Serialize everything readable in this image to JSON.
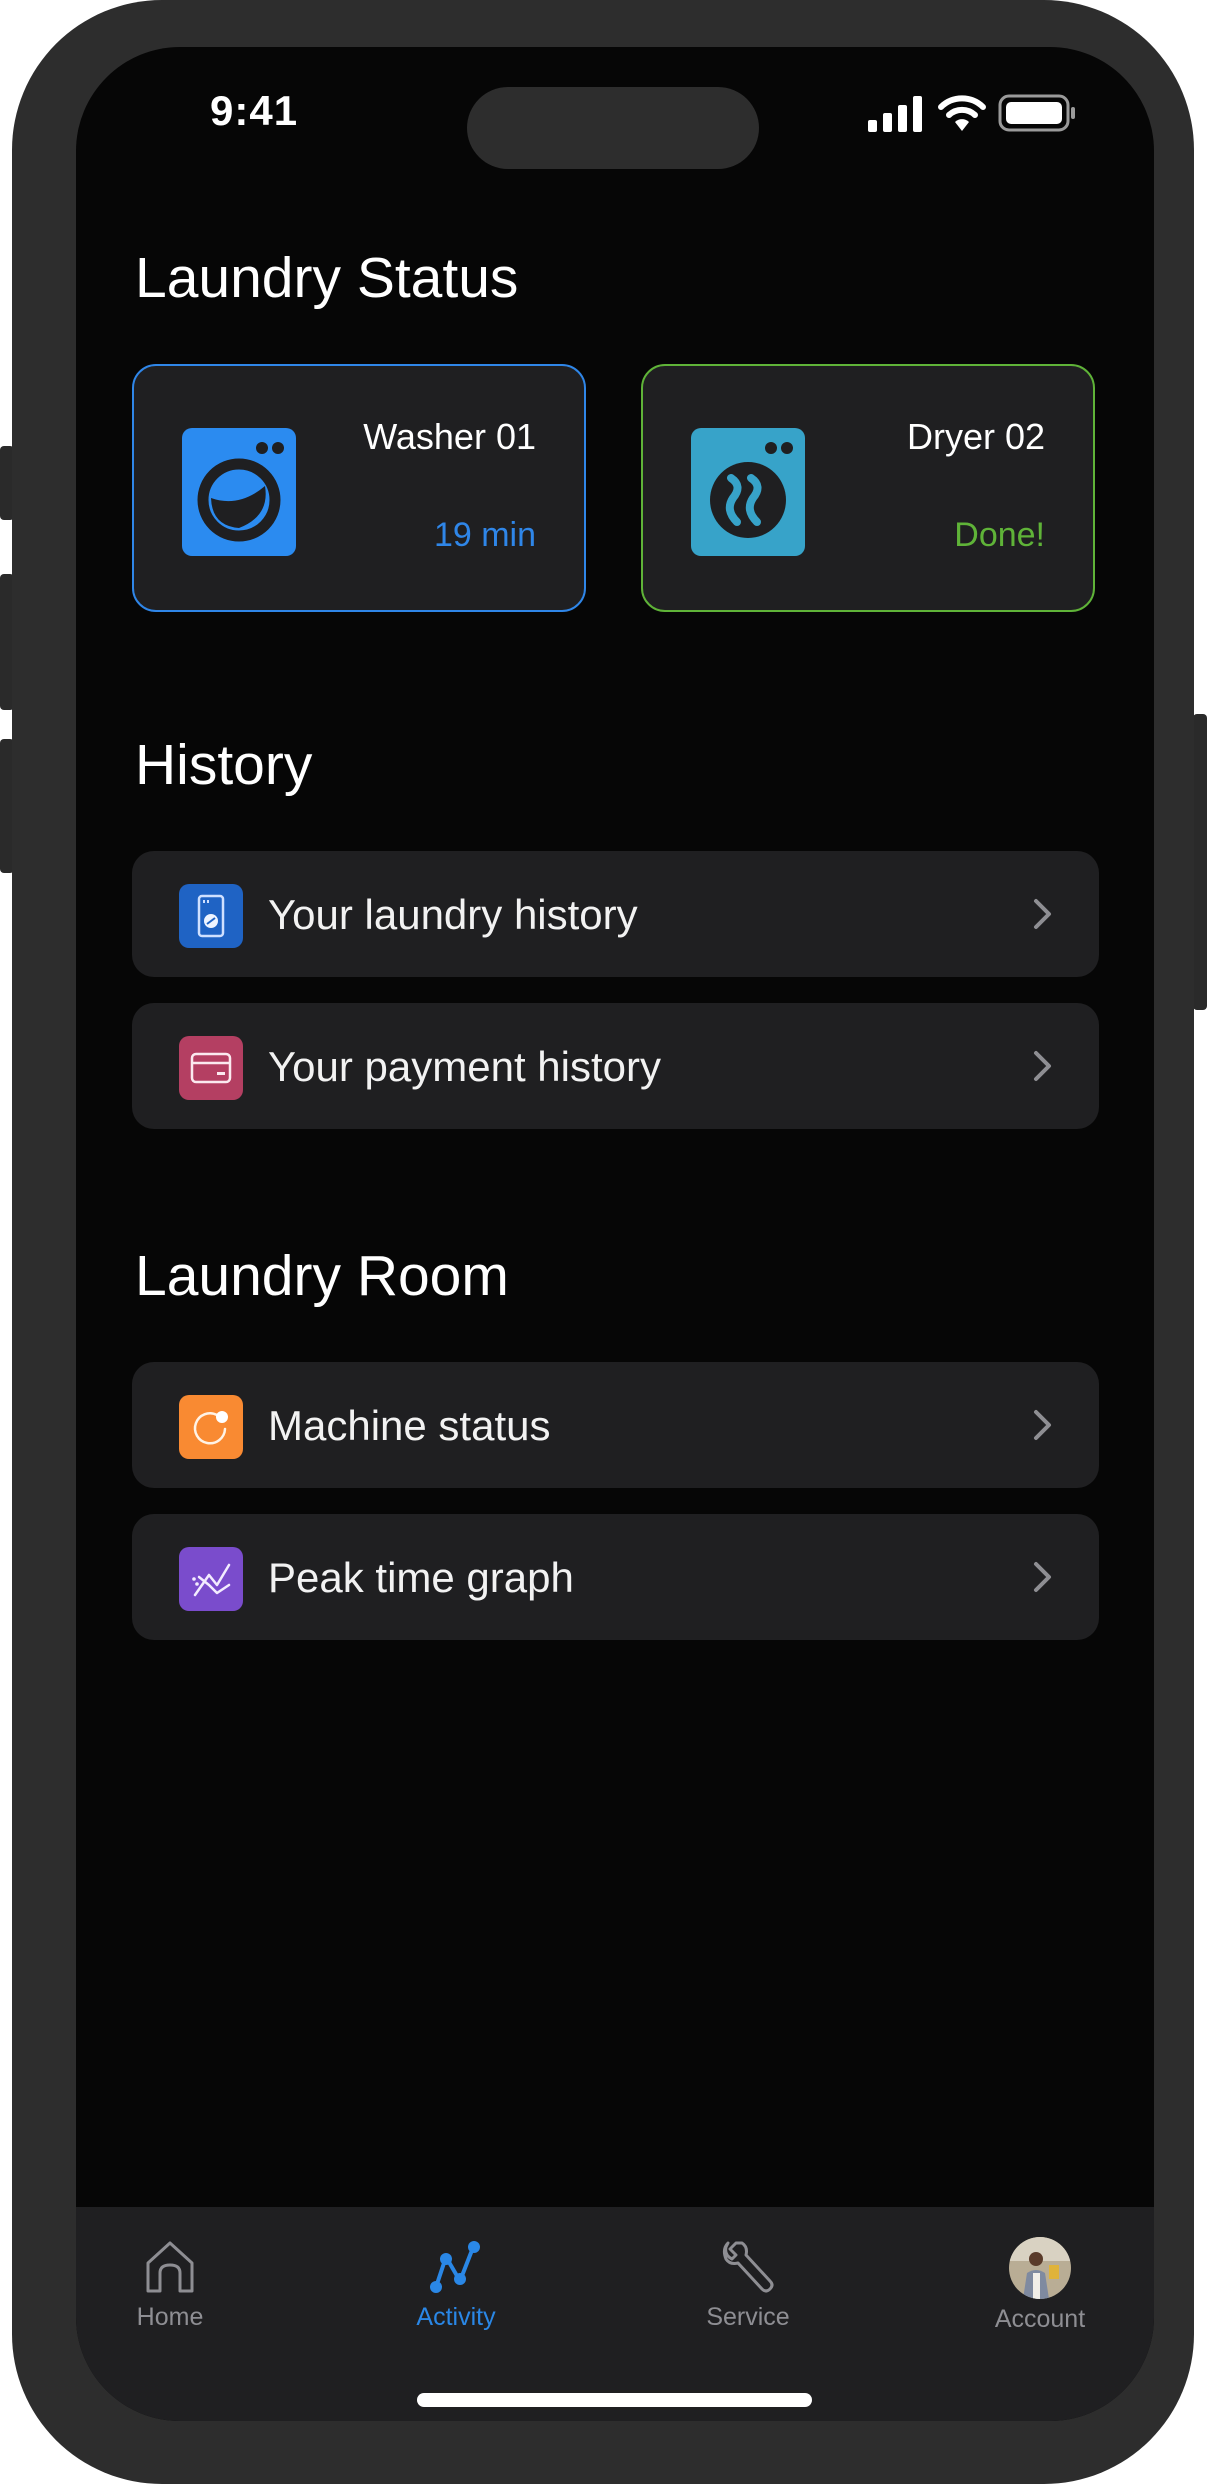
{
  "status_bar": {
    "time": "9:41"
  },
  "sections": {
    "laundry_status": {
      "title": "Laundry Status"
    },
    "history": {
      "title": "History"
    },
    "laundry_room": {
      "title": "Laundry Room"
    }
  },
  "machines": [
    {
      "name": "Washer 01",
      "status": "19 min",
      "icon": "washer-icon",
      "accent": "#2f86e8",
      "icon_color": "#2b8bf0"
    },
    {
      "name": "Dryer 02",
      "status": "Done!",
      "icon": "dryer-icon",
      "accent": "#5fb338",
      "icon_color": "#37a3c9"
    }
  ],
  "history_items": [
    {
      "label": "Your laundry history",
      "icon": "washing-machine-icon",
      "icon_bg": "#1f63c4"
    },
    {
      "label": "Your payment history",
      "icon": "credit-card-icon",
      "icon_bg": "#b43f62"
    }
  ],
  "room_items": [
    {
      "label": "Machine status",
      "icon": "status-ring-icon",
      "icon_bg": "#f98a32"
    },
    {
      "label": "Peak time graph",
      "icon": "trend-graph-icon",
      "icon_bg": "#7a4ccc"
    }
  ],
  "tabs": [
    {
      "label": "Home",
      "icon": "home-icon",
      "active": false
    },
    {
      "label": "Activity",
      "icon": "activity-icon",
      "active": true
    },
    {
      "label": "Service",
      "icon": "wrench-icon",
      "active": false
    },
    {
      "label": "Account",
      "icon": "avatar",
      "active": false
    }
  ],
  "colors": {
    "active_tab": "#2a87e6",
    "inactive_tab": "#8e8e93"
  }
}
